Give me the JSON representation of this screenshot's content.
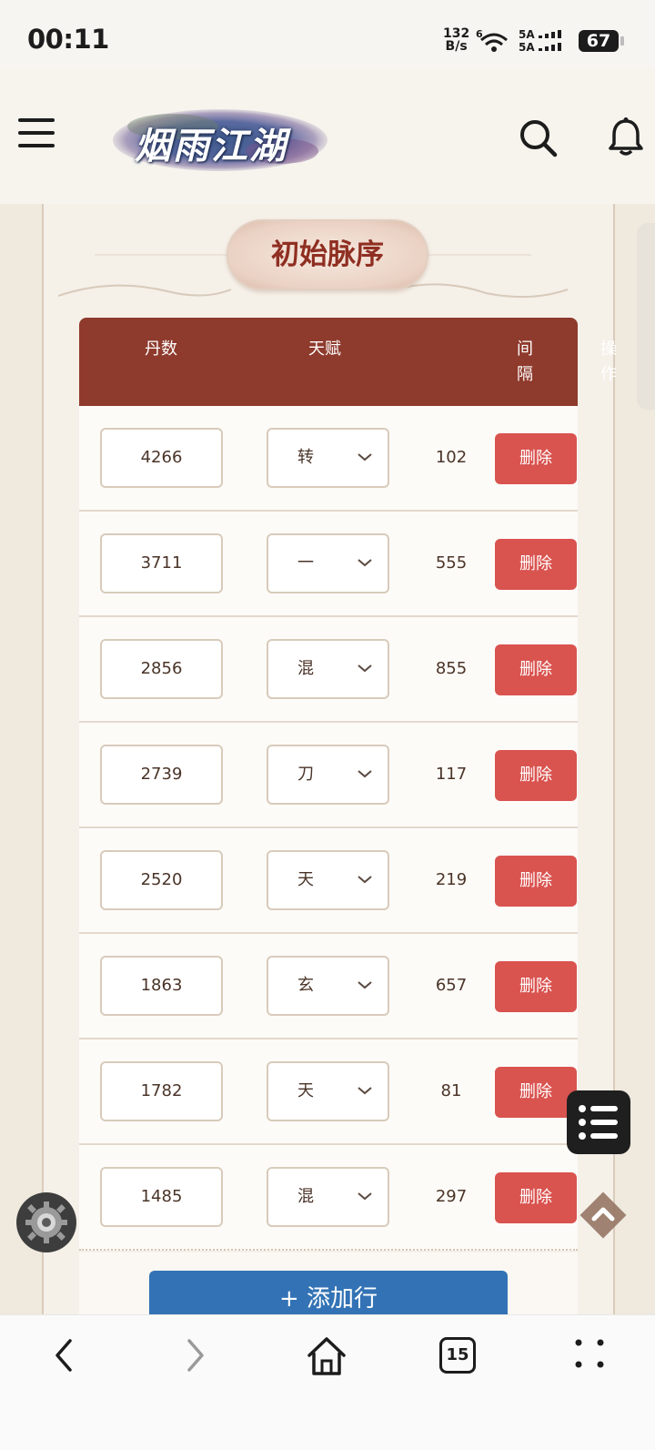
{
  "status_bar": {
    "time": "00:11",
    "net_speed_value": "132",
    "net_speed_unit": "B/s",
    "battery": "67"
  },
  "header": {
    "logo_text": "烟雨江湖"
  },
  "page": {
    "title": "初始脉序"
  },
  "table": {
    "headers": {
      "dan": "丹数",
      "tianfu": "天赋",
      "interval": "间隔",
      "op": "操作"
    },
    "rows": [
      {
        "dan": "4266",
        "tianfu": "转",
        "interval": "102",
        "action": "删除"
      },
      {
        "dan": "3711",
        "tianfu": "一",
        "interval": "555",
        "action": "删除"
      },
      {
        "dan": "2856",
        "tianfu": "混",
        "interval": "855",
        "action": "删除"
      },
      {
        "dan": "2739",
        "tianfu": "刀",
        "interval": "117",
        "action": "删除"
      },
      {
        "dan": "2520",
        "tianfu": "天",
        "interval": "219",
        "action": "删除"
      },
      {
        "dan": "1863",
        "tianfu": "玄",
        "interval": "657",
        "action": "删除"
      },
      {
        "dan": "1782",
        "tianfu": "天",
        "interval": "81",
        "action": "删除"
      },
      {
        "dan": "1485",
        "tianfu": "混",
        "interval": "297",
        "action": "删除"
      }
    ],
    "add_row_label": "+ 添加行"
  },
  "bottom_nav": {
    "tabs_count": "15"
  },
  "colors": {
    "header_bar": "#8e3a2c",
    "delete_button": "#d9534f",
    "add_button": "#3373b5",
    "title_text": "#8f2f22"
  }
}
